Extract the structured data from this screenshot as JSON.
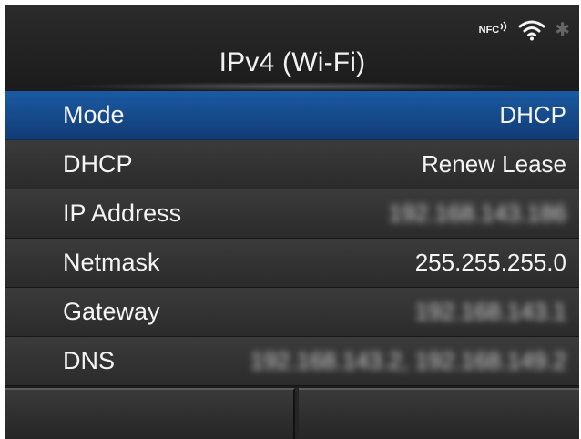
{
  "header": {
    "title": "IPv4 (Wi-Fi)",
    "status_icons": [
      "nfc-icon",
      "wifi-icon",
      "bluetooth-icon"
    ],
    "nfc_label": "NFC",
    "bluetooth_glyph": "✱"
  },
  "rows": [
    {
      "label": "Mode",
      "value": "DHCP",
      "selected": true
    },
    {
      "label": "DHCP",
      "value": "Renew Lease",
      "selected": false
    },
    {
      "label": "IP Address",
      "value": "192.168.143.186",
      "selected": false,
      "obscured": true
    },
    {
      "label": "Netmask",
      "value": "255.255.255.0",
      "selected": false
    },
    {
      "label": "Gateway",
      "value": "192.168.143.1",
      "selected": false,
      "obscured": true
    },
    {
      "label": "DNS",
      "value": "192.168.143.2, 192.168.149.2",
      "selected": false,
      "obscured": true
    }
  ],
  "footer": {
    "left_softkey": "",
    "right_softkey": ""
  },
  "colors": {
    "selected_row": "#1b5aa3",
    "row_background": "#333333",
    "text": "#f4f4f4",
    "screen_background": "#1d1d1d"
  }
}
